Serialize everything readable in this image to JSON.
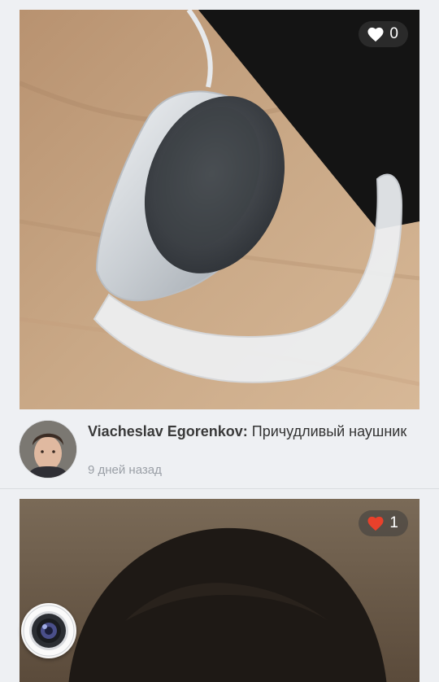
{
  "feed": {
    "posts": [
      {
        "likes": "0",
        "liked": false,
        "author": "Viacheslav Egorenkov:",
        "caption": "Причудливый наушник",
        "time": "9 дней назад",
        "photo_icon": "headset-photo"
      },
      {
        "likes": "1",
        "liked": true,
        "photo_icon": "portrait-photo"
      }
    ]
  },
  "colors": {
    "background": "#eef0f3",
    "liked_heart": "#e8412b",
    "unliked_heart": "#ffffff",
    "meta_text": "#9a9fa6"
  },
  "icons": {
    "like": "heart-icon",
    "camera": "camera-icon",
    "avatar": "avatar"
  }
}
